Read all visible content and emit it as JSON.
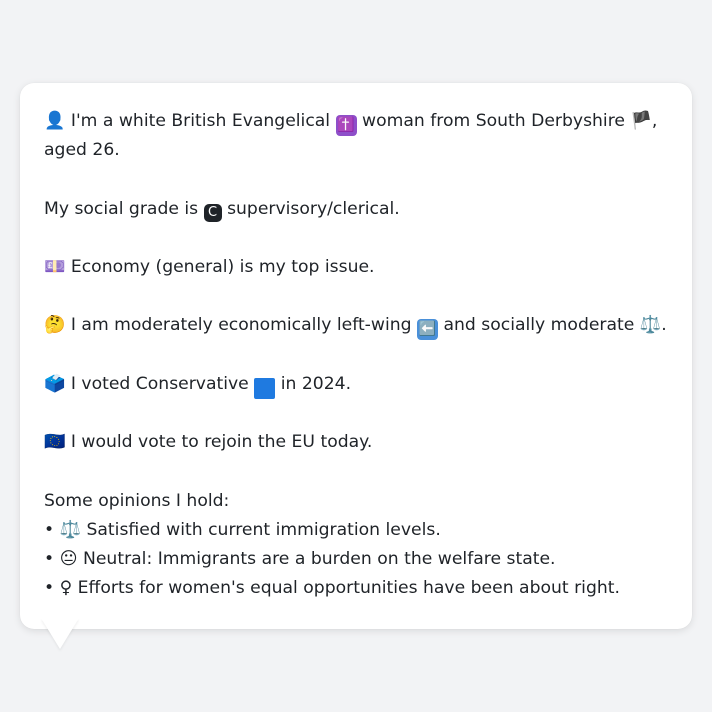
{
  "profile": {
    "line1": {
      "icon_person": "👤",
      "text_a": "I'm a white British Evangelical",
      "icon_cross": "✝️",
      "text_b": "woman from South Derbyshire",
      "icon_flag": "🏴",
      "text_c": ", aged 26."
    },
    "line2": {
      "text_a": "My social grade is",
      "icon_grade": "C",
      "text_b": "supervisory/clerical."
    },
    "line3": {
      "icon_issue": "💷",
      "text": "Economy (general) is my top issue."
    },
    "line4": {
      "icon_think": "🤔",
      "text_a": "I am moderately economically left-wing",
      "icon_left": "⬅️",
      "text_b": "and socially moderate",
      "icon_scale": "⚖️",
      "text_c": "."
    },
    "line5": {
      "icon_ballot": "🗳️",
      "text_a": "I voted Conservative",
      "icon_square": "🟦",
      "text_b": "in 2024."
    },
    "line6": {
      "icon_eu": "🇪🇺",
      "text": "I would vote to rejoin the EU today."
    }
  },
  "opinions": {
    "heading": "Some opinions I hold:",
    "items": [
      {
        "bullet": "•",
        "icon": "⚖️",
        "text": "Satisfied with current immigration levels."
      },
      {
        "bullet": "•",
        "icon": "😐",
        "text": "Neutral: Immigrants are a burden on the welfare state."
      },
      {
        "bullet": "•",
        "icon": "♀",
        "text": "Efforts for women's equal opportunities have been about right."
      }
    ]
  },
  "colors": {
    "background": "#f2f3f5",
    "bubble": "#ffffff",
    "text": "#1f2328",
    "cross_icon_bg": "#8e4fc9",
    "grade_icon_bg": "#1f2328",
    "left_arrow_bg": "#4a90d9",
    "conservative_square": "#1f7ae0"
  }
}
